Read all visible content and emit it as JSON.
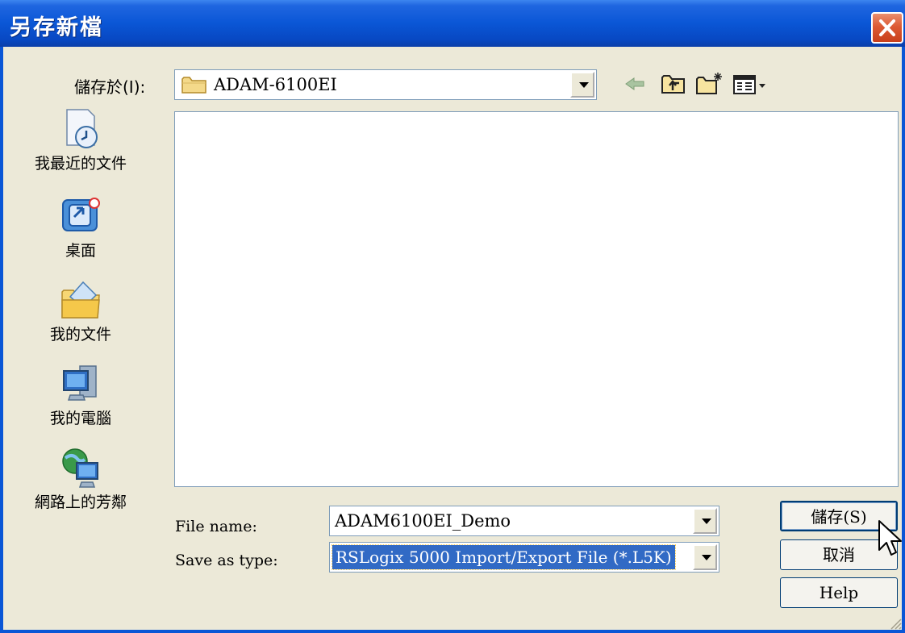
{
  "window": {
    "title": "另存新檔"
  },
  "toolbar": {
    "save_in_label": "儲存於(I):",
    "save_in_value": "ADAM-6100EI",
    "icons": [
      "back-icon",
      "up-folder-icon",
      "new-folder-icon",
      "views-menu-icon"
    ]
  },
  "places": [
    {
      "label": "我最近的文件",
      "icon": "recent-documents-icon"
    },
    {
      "label": "桌面",
      "icon": "desktop-icon"
    },
    {
      "label": "我的文件",
      "icon": "my-documents-icon"
    },
    {
      "label": "我的電腦",
      "icon": "my-computer-icon"
    },
    {
      "label": "網路上的芳鄰",
      "icon": "network-places-icon"
    }
  ],
  "form": {
    "file_name_label": "File name:",
    "file_name_value": "ADAM6100EI_Demo",
    "save_type_label": "Save as type:",
    "save_type_value": "RSLogix 5000 Import/Export File (*.L5K)"
  },
  "buttons": {
    "save": "儲存(S)",
    "cancel": "取消",
    "help": "Help"
  },
  "colors": {
    "title_bar": "#0a56d6",
    "close_button": "#dd5a34",
    "selection": "#316ac5",
    "dialog_bg": "#ece9d8"
  }
}
